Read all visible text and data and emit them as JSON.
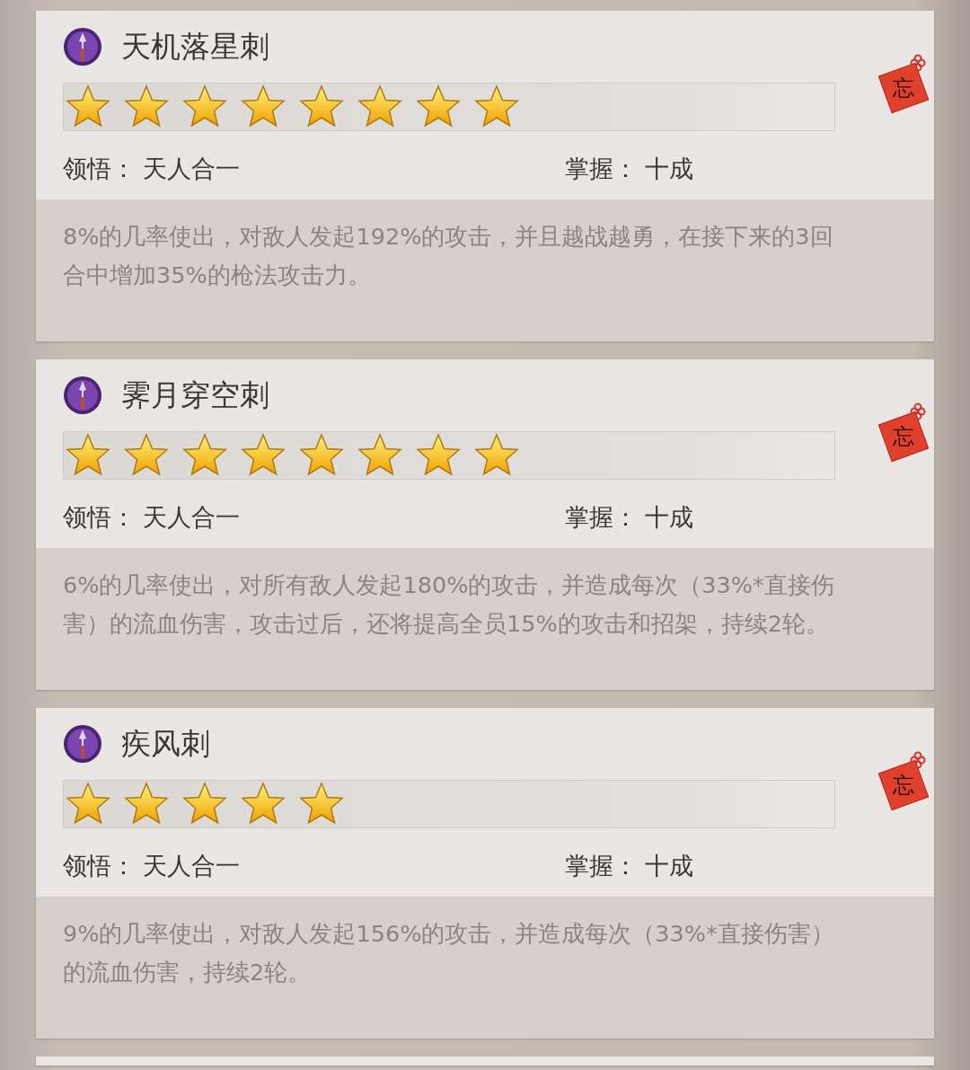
{
  "skills": [
    {
      "name": "天机落星刺",
      "stars": 8,
      "tag": "忘",
      "comprehension_label": "领悟：",
      "comprehension": "天人合一",
      "mastery_label": "掌握：",
      "mastery": "十成",
      "description": "8%的几率使出，对敌人发起192%的攻击，并且越战越勇，在接下来的3回合中增加35%的枪法攻击力。"
    },
    {
      "name": "霁月穿空刺",
      "stars": 8,
      "tag": "忘",
      "comprehension_label": "领悟：",
      "comprehension": "天人合一",
      "mastery_label": "掌握：",
      "mastery": "十成",
      "description": "6%的几率使出，对所有敌人发起180%的攻击，并造成每次（33%*直接伤害）的流血伤害，攻击过后，还将提高全员15%的攻击和招架，持续2轮。"
    },
    {
      "name": "疾风刺",
      "stars": 5,
      "tag": "忘",
      "comprehension_label": "领悟：",
      "comprehension": "天人合一",
      "mastery_label": "掌握：",
      "mastery": "十成",
      "description": "9%的几率使出，对敌人发起156%的攻击，并造成每次（33%*直接伤害）的流血伤害，持续2轮。"
    }
  ]
}
